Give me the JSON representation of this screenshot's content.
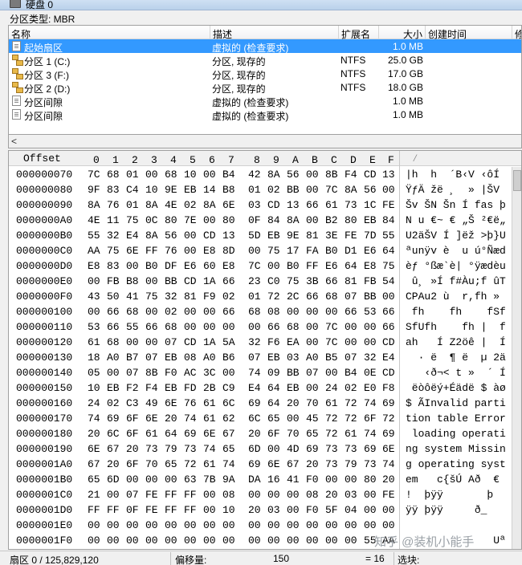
{
  "window": {
    "title": "硬盘 0"
  },
  "partition_type": "分区类型: MBR",
  "table": {
    "columns": [
      "名称",
      "描述",
      "扩展名",
      "大小",
      "创建时间",
      "修"
    ],
    "rows": [
      {
        "icon": "file-icon",
        "name": "起始扇区",
        "desc": "虚拟的 (检查要求)",
        "ext": "",
        "size": "1.0 MB",
        "selected": true
      },
      {
        "icon": "partition-icon",
        "name": "分区 1 (C:)",
        "desc": "分区, 现存的",
        "ext": "NTFS",
        "size": "25.0 GB",
        "selected": false
      },
      {
        "icon": "partition-icon",
        "name": "分区 3 (F:)",
        "desc": "分区, 现存的",
        "ext": "NTFS",
        "size": "17.0 GB",
        "selected": false
      },
      {
        "icon": "partition-icon",
        "name": "分区 2 (D:)",
        "desc": "分区, 现存的",
        "ext": "NTFS",
        "size": "18.0 GB",
        "selected": false
      },
      {
        "icon": "file-icon",
        "name": "分区间隙",
        "desc": "虚拟的 (检查要求)",
        "ext": "",
        "size": "1.0 MB",
        "selected": false
      },
      {
        "icon": "file-icon",
        "name": "分区间隙",
        "desc": "虚拟的 (检查要求)",
        "ext": "",
        "size": "1.0 MB",
        "selected": false
      }
    ]
  },
  "scroll_left_arrow": "<",
  "hex": {
    "offset_label": "Offset",
    "col_labels": [
      "0",
      "1",
      "2",
      "3",
      "4",
      "5",
      "6",
      "7",
      "8",
      "9",
      "A",
      "B",
      "C",
      "D",
      "E",
      "F"
    ],
    "ascii_header": "⁄",
    "rows": [
      {
        "offset": "000000070",
        "bytes": [
          "7C",
          "68",
          "01",
          "00",
          "68",
          "10",
          "00",
          "B4",
          "42",
          "8A",
          "56",
          "00",
          "8B",
          "F4",
          "CD",
          "13"
        ],
        "ascii": "|h  h  ´B‹V ‹ôÍ"
      },
      {
        "offset": "000000080",
        "bytes": [
          "9F",
          "83",
          "C4",
          "10",
          "9E",
          "EB",
          "14",
          "B8",
          "01",
          "02",
          "BB",
          "00",
          "7C",
          "8A",
          "56",
          "00"
        ],
        "ascii": "ŸƒÄ žë ¸  » |ŠV"
      },
      {
        "offset": "000000090",
        "bytes": [
          "8A",
          "76",
          "01",
          "8A",
          "4E",
          "02",
          "8A",
          "6E",
          "03",
          "CD",
          "13",
          "66",
          "61",
          "73",
          "1C",
          "FE"
        ],
        "ascii": "Šv ŠN Šn Í fas þ"
      },
      {
        "offset": "0000000A0",
        "bytes": [
          "4E",
          "11",
          "75",
          "0C",
          "80",
          "7E",
          "00",
          "80",
          "0F",
          "84",
          "8A",
          "00",
          "B2",
          "80",
          "EB",
          "84"
        ],
        "ascii": "N u €~ € „Š ²€ë„"
      },
      {
        "offset": "0000000B0",
        "bytes": [
          "55",
          "32",
          "E4",
          "8A",
          "56",
          "00",
          "CD",
          "13",
          "5D",
          "EB",
          "9E",
          "81",
          "3E",
          "FE",
          "7D",
          "55"
        ],
        "ascii": "U2äŠV Í ]ëž >þ}U"
      },
      {
        "offset": "0000000C0",
        "bytes": [
          "AA",
          "75",
          "6E",
          "FF",
          "76",
          "00",
          "E8",
          "8D",
          "00",
          "75",
          "17",
          "FA",
          "B0",
          "D1",
          "E6",
          "64"
        ],
        "ascii": "ªunÿv è  u ú°Ñæd"
      },
      {
        "offset": "0000000D0",
        "bytes": [
          "E8",
          "83",
          "00",
          "B0",
          "DF",
          "E6",
          "60",
          "E8",
          "7C",
          "00",
          "B0",
          "FF",
          "E6",
          "64",
          "E8",
          "75"
        ],
        "ascii": "èƒ °ßæ`è| °ÿædèu"
      },
      {
        "offset": "0000000E0",
        "bytes": [
          "00",
          "FB",
          "B8",
          "00",
          "BB",
          "CD",
          "1A",
          "66",
          "23",
          "C0",
          "75",
          "3B",
          "66",
          "81",
          "FB",
          "54"
        ],
        "ascii": " û¸ »Í f#Àu;f ûT"
      },
      {
        "offset": "0000000F0",
        "bytes": [
          "43",
          "50",
          "41",
          "75",
          "32",
          "81",
          "F9",
          "02",
          "01",
          "72",
          "2C",
          "66",
          "68",
          "07",
          "BB",
          "00"
        ],
        "ascii": "CPAu2 ù  r,fh »"
      },
      {
        "offset": "000000100",
        "bytes": [
          "00",
          "66",
          "68",
          "00",
          "02",
          "00",
          "00",
          "66",
          "68",
          "08",
          "00",
          "00",
          "00",
          "66",
          "53",
          "66"
        ],
        "ascii": " fh    fh    fSf"
      },
      {
        "offset": "000000110",
        "bytes": [
          "53",
          "66",
          "55",
          "66",
          "68",
          "00",
          "00",
          "00",
          "00",
          "66",
          "68",
          "00",
          "7C",
          "00",
          "00",
          "66"
        ],
        "ascii": "SfUfh    fh |  f"
      },
      {
        "offset": "000000120",
        "bytes": [
          "61",
          "68",
          "00",
          "00",
          "07",
          "CD",
          "1A",
          "5A",
          "32",
          "F6",
          "EA",
          "00",
          "7C",
          "00",
          "00",
          "CD"
        ],
        "ascii": "ah   Í Z2öê |  Í"
      },
      {
        "offset": "000000130",
        "bytes": [
          "18",
          "A0",
          "B7",
          "07",
          "EB",
          "08",
          "A0",
          "B6",
          "07",
          "EB",
          "03",
          "A0",
          "B5",
          "07",
          "32",
          "E4"
        ],
        "ascii": "  · ë  ¶ ë  µ 2ä"
      },
      {
        "offset": "000000140",
        "bytes": [
          "05",
          "00",
          "07",
          "8B",
          "F0",
          "AC",
          "3C",
          "00",
          "74",
          "09",
          "BB",
          "07",
          "00",
          "B4",
          "0E",
          "CD"
        ],
        "ascii": "   ‹ð¬< t »  ´ Í"
      },
      {
        "offset": "000000150",
        "bytes": [
          "10",
          "EB",
          "F2",
          "F4",
          "EB",
          "FD",
          "2B",
          "C9",
          "E4",
          "64",
          "EB",
          "00",
          "24",
          "02",
          "E0",
          "F8"
        ],
        "ascii": " ëòôëý+Éädë $ àø"
      },
      {
        "offset": "000000160",
        "bytes": [
          "24",
          "02",
          "C3",
          "49",
          "6E",
          "76",
          "61",
          "6C",
          "69",
          "64",
          "20",
          "70",
          "61",
          "72",
          "74",
          "69"
        ],
        "ascii": "$ ÃInvalid parti"
      },
      {
        "offset": "000000170",
        "bytes": [
          "74",
          "69",
          "6F",
          "6E",
          "20",
          "74",
          "61",
          "62",
          "6C",
          "65",
          "00",
          "45",
          "72",
          "72",
          "6F",
          "72"
        ],
        "ascii": "tion table Error"
      },
      {
        "offset": "000000180",
        "bytes": [
          "20",
          "6C",
          "6F",
          "61",
          "64",
          "69",
          "6E",
          "67",
          "20",
          "6F",
          "70",
          "65",
          "72",
          "61",
          "74",
          "69"
        ],
        "ascii": " loading operati"
      },
      {
        "offset": "000000190",
        "bytes": [
          "6E",
          "67",
          "20",
          "73",
          "79",
          "73",
          "74",
          "65",
          "6D",
          "00",
          "4D",
          "69",
          "73",
          "73",
          "69",
          "6E"
        ],
        "ascii": "ng system Missin"
      },
      {
        "offset": "0000001A0",
        "bytes": [
          "67",
          "20",
          "6F",
          "70",
          "65",
          "72",
          "61",
          "74",
          "69",
          "6E",
          "67",
          "20",
          "73",
          "79",
          "73",
          "74"
        ],
        "ascii": "g operating syst"
      },
      {
        "offset": "0000001B0",
        "bytes": [
          "65",
          "6D",
          "00",
          "00",
          "00",
          "63",
          "7B",
          "9A",
          "DA",
          "16",
          "41",
          "F0",
          "00",
          "00",
          "80",
          "20"
        ],
        "ascii": "em   c{šÚ Að  € "
      },
      {
        "offset": "0000001C0",
        "bytes": [
          "21",
          "00",
          "07",
          "FE",
          "FF",
          "FF",
          "00",
          "08",
          "00",
          "00",
          "00",
          "08",
          "20",
          "03",
          "00",
          "FE"
        ],
        "ascii": "!  þÿÿ       þ"
      },
      {
        "offset": "0000001D0",
        "bytes": [
          "FF",
          "FF",
          "0F",
          "FE",
          "FF",
          "FF",
          "00",
          "10",
          "20",
          "03",
          "00",
          "F0",
          "5F",
          "04",
          "00",
          "00"
        ],
        "ascii": "ÿÿ þÿÿ     ð_"
      },
      {
        "offset": "0000001E0",
        "bytes": [
          "00",
          "00",
          "00",
          "00",
          "00",
          "00",
          "00",
          "00",
          "00",
          "00",
          "00",
          "00",
          "00",
          "00",
          "00",
          "00"
        ],
        "ascii": ""
      },
      {
        "offset": "0000001F0",
        "bytes": [
          "00",
          "00",
          "00",
          "00",
          "00",
          "00",
          "00",
          "00",
          "00",
          "00",
          "00",
          "00",
          "00",
          "00",
          "55",
          "AA"
        ],
        "ascii": "              Uª"
      }
    ]
  },
  "status": {
    "sector": "扇区 0 / 125,829,120",
    "offset_label": "偏移量:",
    "offset_value": "150",
    "eq": "= 16",
    "selection_label": "选块:"
  },
  "watermark": "知乎 @装机小能手"
}
